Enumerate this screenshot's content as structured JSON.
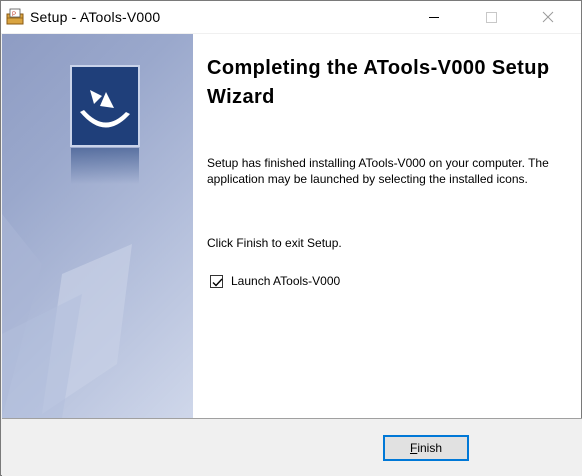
{
  "window": {
    "title": "Setup - ATools-V000"
  },
  "icons": {
    "app": "setup-package-icon",
    "minimize": "minimize-icon",
    "maximize": "maximize-icon",
    "close": "close-icon",
    "wizard_logo": "installer-logo-icon",
    "check": "checkmark-icon"
  },
  "content": {
    "heading": "Completing the ATools-V000 Setup Wizard",
    "description": "Setup has finished installing ATools-V000 on your computer. The application may be launched by selecting the installed icons.",
    "exit_text": "Click Finish to exit Setup.",
    "launch_checkbox": {
      "label": "Launch ATools-V000",
      "checked": true
    }
  },
  "footer": {
    "finish_label": "Finish"
  },
  "colors": {
    "accent": "#0078d7",
    "sidebar_dark": "#1f3f7a",
    "sidebar_light": "#cfd7ea"
  }
}
